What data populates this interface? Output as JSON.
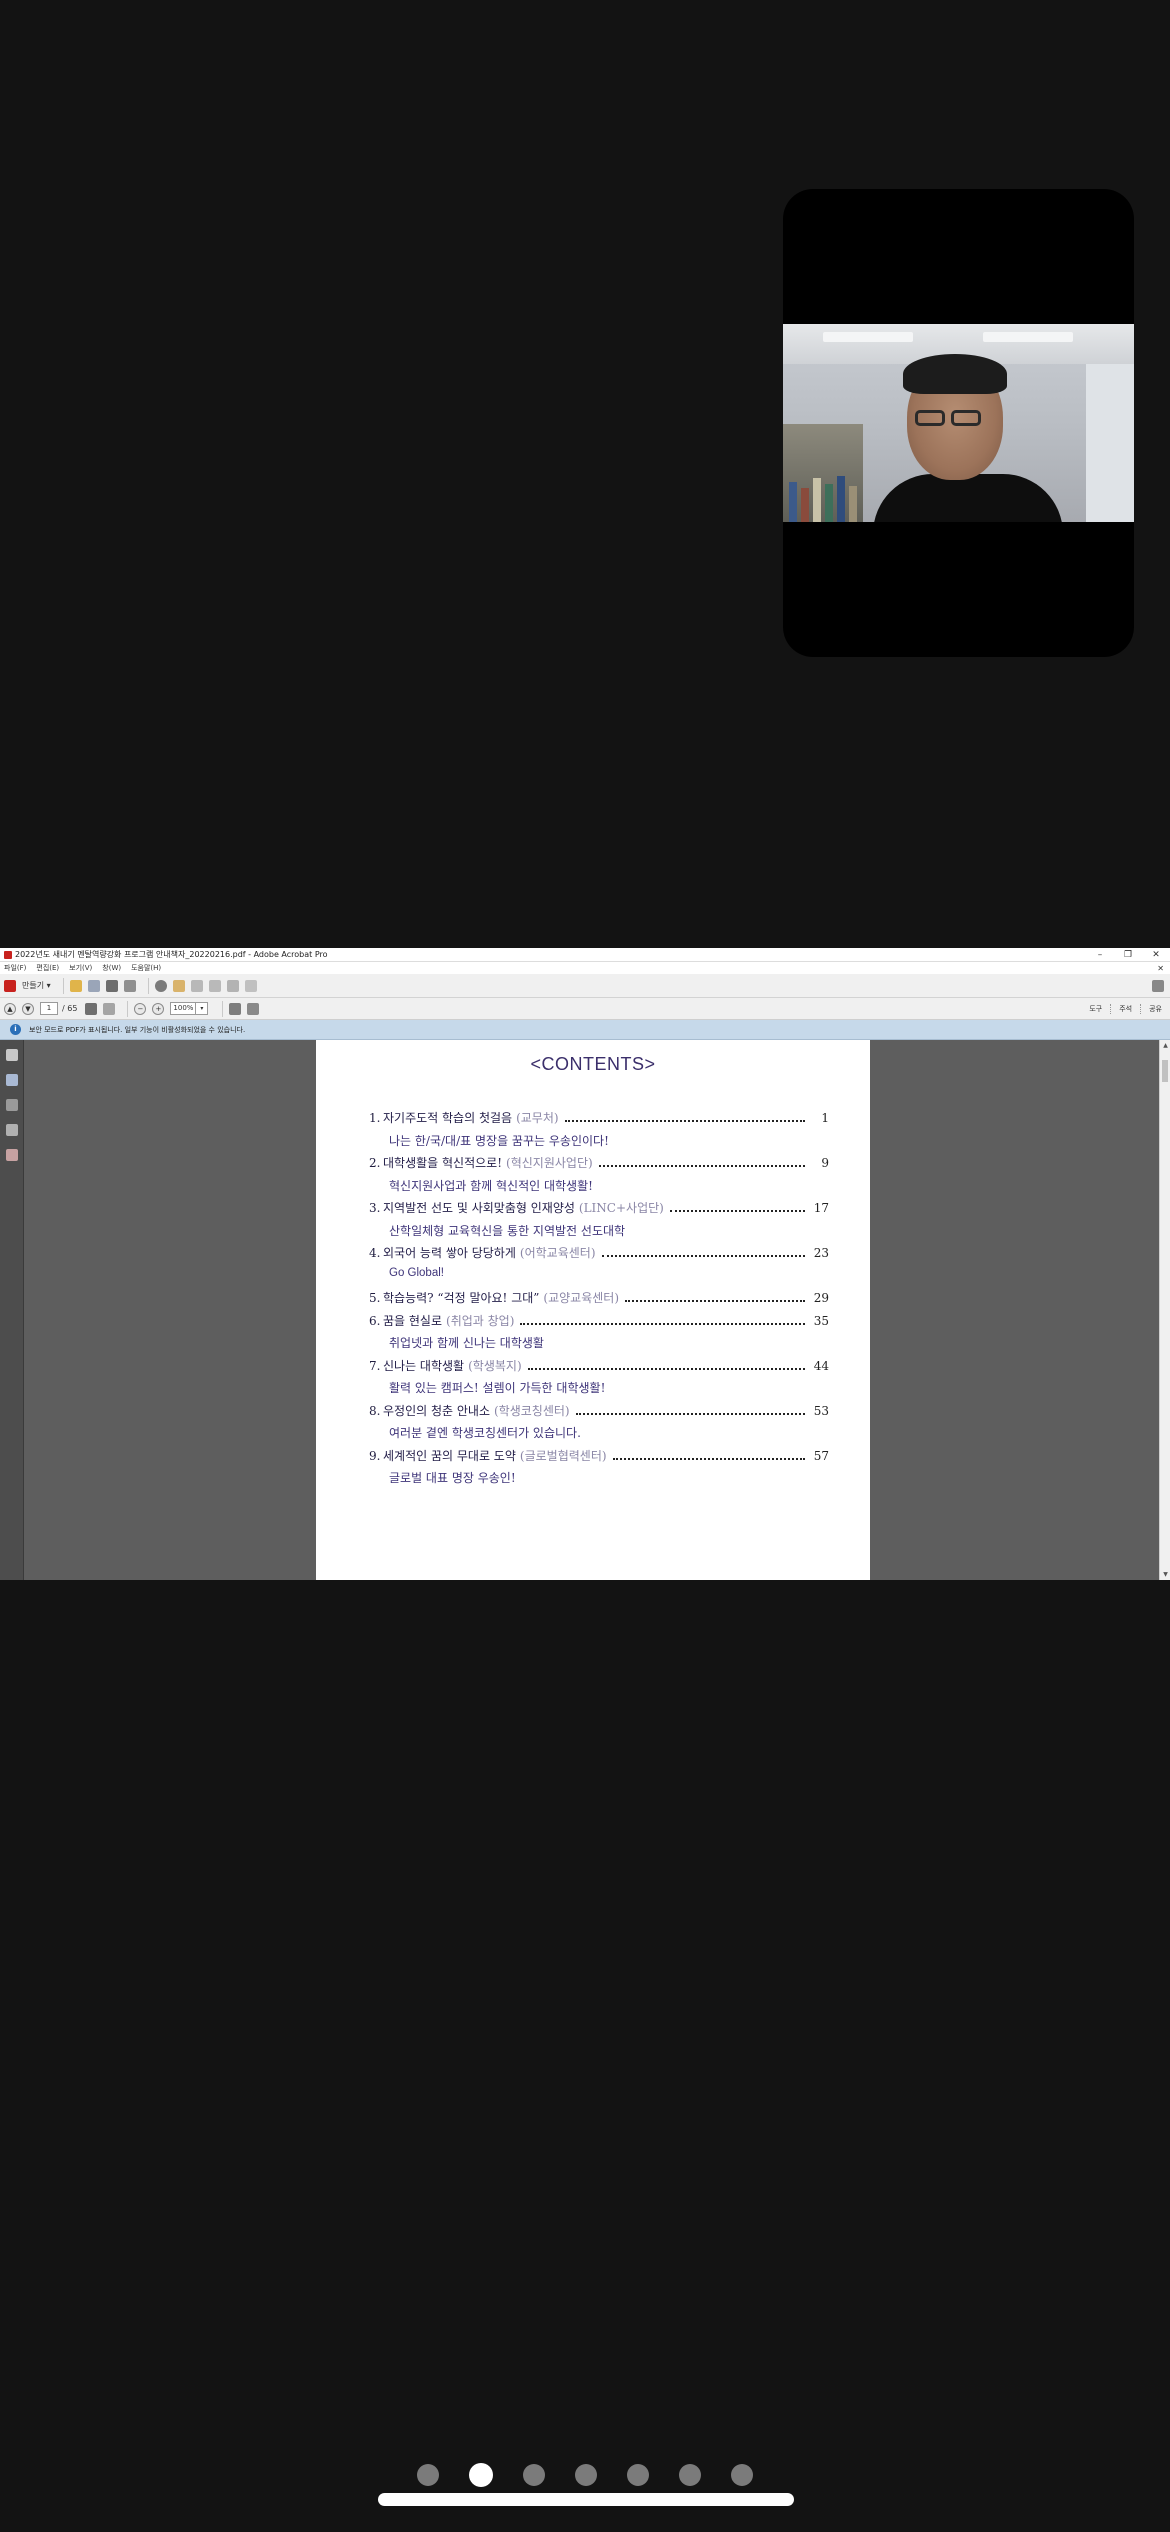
{
  "acrobat": {
    "title": "2022년도 새내기 멘탈역량강화 프로그램 안내책자_20220216.pdf - Adobe Acrobat Pro",
    "window_controls": [
      "–",
      "❐",
      "✕"
    ],
    "menu": [
      "파일(F)",
      "편집(E)",
      "보기(V)",
      "창(W)",
      "도움말(H)"
    ],
    "menu_close": "✕",
    "create_label": "만들기 ▾",
    "page_current": "1",
    "page_total": "/ 65",
    "zoom": "100%",
    "right_links": [
      "도구",
      "주석",
      "공유"
    ],
    "info_message": "보안 모드로 PDF가 표시됩니다. 일부 기능이 비활성화되었을 수 있습니다."
  },
  "document": {
    "title": "<CONTENTS>",
    "toc": [
      {
        "num": "1.",
        "main": "자기주도적 학습의 첫걸음",
        "org": "(교무처)",
        "page": "1",
        "sub": "나는 한/국/대/표 명장을 꿈꾸는 우송인이다!"
      },
      {
        "num": "2.",
        "main": "대학생활을 혁신적으로!",
        "org": "(혁신지원사업단)",
        "page": "9",
        "sub": "혁신지원사업과 함께 혁신적인 대학생활!"
      },
      {
        "num": "3.",
        "main": "지역발전 선도 및 사회맞춤형 인재양성",
        "org": "(LINC+사업단)",
        "page": "17",
        "sub": "산학일체형 교육혁신을 통한 지역발전 선도대학"
      },
      {
        "num": "4.",
        "main": "외국어 능력 쌓아 당당하게",
        "org": "(어학교육센터)",
        "page": "23",
        "sub": "Go Global!"
      },
      {
        "num": "5.",
        "main": "학습능력? “걱정 말아요! 그대”",
        "org": "(교양교육센터)",
        "page": "29",
        "sub": ""
      },
      {
        "num": "6.",
        "main": "꿈을 현실로",
        "org": "(취업과 창업)",
        "page": "35",
        "sub": "취업넷과 함께 신나는 대학생활"
      },
      {
        "num": "7.",
        "main": "신나는 대학생활",
        "org": "(학생복지)",
        "page": "44",
        "sub": "활력 있는 캠퍼스! 설렘이 가득한 대학생활!"
      },
      {
        "num": "8.",
        "main": "우정인의 청춘 안내소",
        "org": "(학생코칭센터)",
        "page": "53",
        "sub": "여러분 곁엔 학생코칭센터가 있습니다."
      },
      {
        "num": "9.",
        "main": "세계적인 꿈의 무대로 도약",
        "org": "(글로벌협력센터)",
        "page": "57",
        "sub": "글로벌 대표 명장 우송인!"
      }
    ]
  },
  "pager": {
    "count": 7,
    "active_index": 1
  },
  "colors": {
    "background": "#131313",
    "heading": "#3b2f6b",
    "subtitle": "#3e3479",
    "infobar": "#c6d9ea"
  },
  "icons": [
    "pdf-app-icon",
    "save-icon",
    "print-icon",
    "email-icon",
    "prev-page-icon",
    "next-page-icon",
    "select-tool-icon",
    "hand-tool-icon",
    "zoom-out-icon",
    "zoom-in-icon",
    "fit-width-icon",
    "fit-page-icon",
    "info-icon",
    "thumbnails-icon",
    "bookmarks-icon",
    "attachments-icon",
    "signatures-icon"
  ]
}
